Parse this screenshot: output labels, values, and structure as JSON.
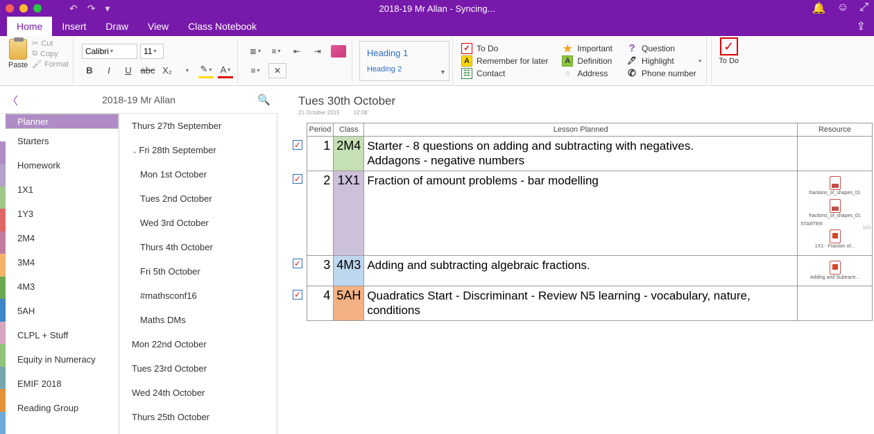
{
  "window": {
    "title": "2018-19 Mr Allan - Syncing..."
  },
  "tabs": {
    "items": [
      "Home",
      "Insert",
      "Draw",
      "View",
      "Class Notebook"
    ],
    "active": 0
  },
  "ribbon": {
    "paste": "Paste",
    "cut": "Cut",
    "copy": "Copy",
    "format": "Format",
    "font_name": "Calibri",
    "font_size": "11",
    "style1": "Heading 1",
    "style2": "Heading 2",
    "tags": {
      "todo": "To Do",
      "remember": "Remember for later",
      "contact": "Contact",
      "important": "Important",
      "definition": "Definition",
      "address": "Address",
      "question": "Question",
      "highlight": "Highlight",
      "phone": "Phone number"
    },
    "todo_big": "To Do"
  },
  "notebook": {
    "title": "2018-19 Mr Allan"
  },
  "sections": [
    {
      "label": "Planner",
      "sel": true,
      "color": "#b08cc6"
    },
    {
      "label": "Starters",
      "color": "#b4a0c8"
    },
    {
      "label": "Homework",
      "color": "#a0c888"
    },
    {
      "label": "1X1",
      "color": "#e06666"
    },
    {
      "label": "1Y3",
      "color": "#c27ba0"
    },
    {
      "label": "2M4",
      "color": "#f6b26b"
    },
    {
      "label": "3M4",
      "color": "#6aa84f"
    },
    {
      "label": "4M3",
      "color": "#3d85c6"
    },
    {
      "label": "5AH",
      "color": "#d5a6bd"
    },
    {
      "label": "CLPL + Stuff",
      "color": "#93c47d"
    },
    {
      "label": "Equity in Numeracy",
      "color": "#76a5af"
    },
    {
      "label": "EMIF 2018",
      "color": "#e69138"
    },
    {
      "label": "Reading Group",
      "color": "#6fa8dc"
    }
  ],
  "pages": [
    {
      "label": "Thurs 27th September",
      "child": false
    },
    {
      "label": "Fri 28th September",
      "child": false,
      "expanded": true
    },
    {
      "label": "Mon 1st October",
      "child": true
    },
    {
      "label": "Tues 2nd October",
      "child": true
    },
    {
      "label": "Wed 3rd October",
      "child": true
    },
    {
      "label": "Thurs 4th October",
      "child": true
    },
    {
      "label": "Fri 5th October",
      "child": true
    },
    {
      "label": "#mathsconf16",
      "child": true
    },
    {
      "label": "Maths DMs",
      "child": true
    },
    {
      "label": "Mon 22nd October",
      "child": false
    },
    {
      "label": "Tues 23rd October",
      "child": false
    },
    {
      "label": "Wed 24th October",
      "child": false
    },
    {
      "label": "Thurs 25th October",
      "child": false
    }
  ],
  "page": {
    "title": "Tues 30th October",
    "date": "21 October 2015",
    "time": "12:08",
    "author": "MA",
    "headers": {
      "period": "Period",
      "class": "Class",
      "lesson": "Lesson Planned",
      "resource": "Resource"
    },
    "rows": [
      {
        "period": "1",
        "class": "2M4",
        "bg": "bg-green",
        "lesson": "Starter - 8 questions on adding and subtracting with negatives.\nAddagons - negative numbers",
        "resources": []
      },
      {
        "period": "2",
        "class": "1X1",
        "bg": "bg-purple",
        "lesson": "Fraction of amount problems - bar modelling",
        "resources": [
          {
            "type": "pdf",
            "name": "fractions_of_shapes_01"
          },
          {
            "type": "pdf",
            "name": "fractions_of_shapes_01"
          },
          {
            "type": "text",
            "name": "STARTER"
          },
          {
            "type": "ppt",
            "name": "1X1 - Fraction of..."
          }
        ]
      },
      {
        "period": "3",
        "class": "4M3",
        "bg": "bg-blue",
        "lesson": "Adding and subtracting algebraic fractions.",
        "resources": [
          {
            "type": "ppt",
            "name": "Adding and Subtractr..."
          }
        ]
      },
      {
        "period": "4",
        "class": "5AH",
        "bg": "bg-orange",
        "lesson": "Quadratics Start - Discriminant - Review N5 learning - vocabulary, nature, conditions",
        "resources": []
      }
    ]
  }
}
